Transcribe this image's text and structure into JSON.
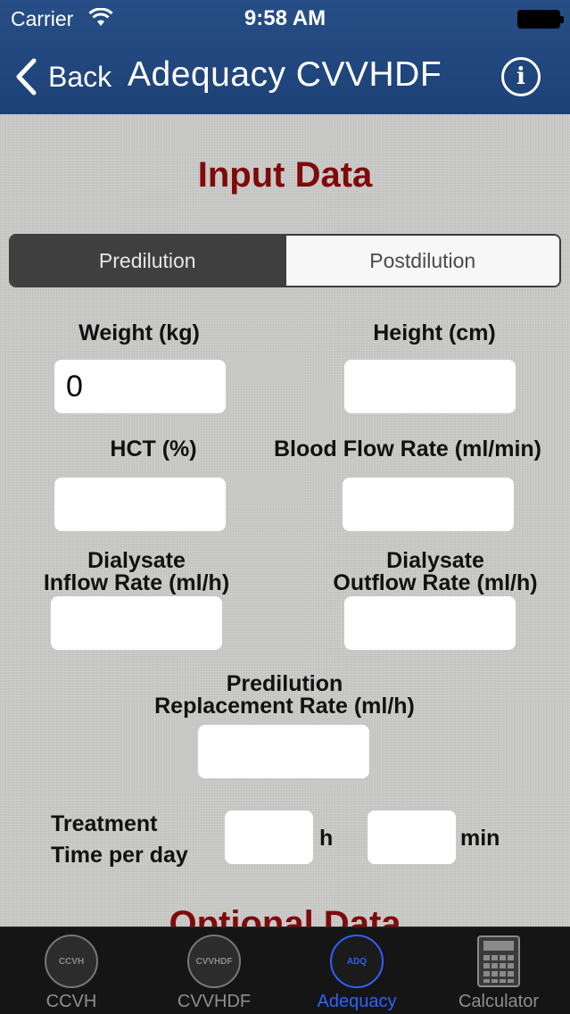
{
  "status": {
    "carrier": "Carrier",
    "time": "9:58 AM"
  },
  "nav": {
    "back_label": "Back",
    "title": "Adequacy CVVHDF",
    "info_glyph": "i"
  },
  "main": {
    "section_title": "Input Data",
    "next_section_title": "Optional Data",
    "segments": [
      {
        "label": "Predilution",
        "selected": true
      },
      {
        "label": "Postdilution",
        "selected": false
      }
    ],
    "fields": {
      "weight": {
        "label": "Weight (kg)",
        "value": "0"
      },
      "height": {
        "label": "Height (cm)",
        "value": ""
      },
      "hct": {
        "label": "HCT (%)",
        "value": ""
      },
      "blood_flow": {
        "label": "Blood Flow Rate (ml/min)",
        "value": ""
      },
      "dialysate_inflow": {
        "label_line1": "Dialysate",
        "label_line2": "Inflow Rate (ml/h)",
        "value": ""
      },
      "dialysate_outflow": {
        "label_line1": "Dialysate",
        "label_line2": "Outflow Rate (ml/h)",
        "value": ""
      },
      "predilution_replacement": {
        "label_line1": "Predilution",
        "label_line2": "Replacement Rate (ml/h)",
        "value": ""
      },
      "treatment_time": {
        "label_line1": "Treatment",
        "label_line2": "Time per day",
        "hours_value": "",
        "hours_unit": "h",
        "minutes_value": "",
        "minutes_unit": "min"
      }
    }
  },
  "tabbar": {
    "items": [
      {
        "label": "CCVH",
        "icon_text": "CCVH",
        "active": false
      },
      {
        "label": "CVVHDF",
        "icon_text": "CVVHDF",
        "active": false
      },
      {
        "label": "Adequacy",
        "icon_text": "ADQ",
        "active": true
      },
      {
        "label": "Calculator",
        "icon_text": "",
        "active": false
      }
    ]
  },
  "colors": {
    "nav_background": "#1f447b",
    "section_title": "#7e0a0a",
    "tab_active": "#2c64ff"
  }
}
